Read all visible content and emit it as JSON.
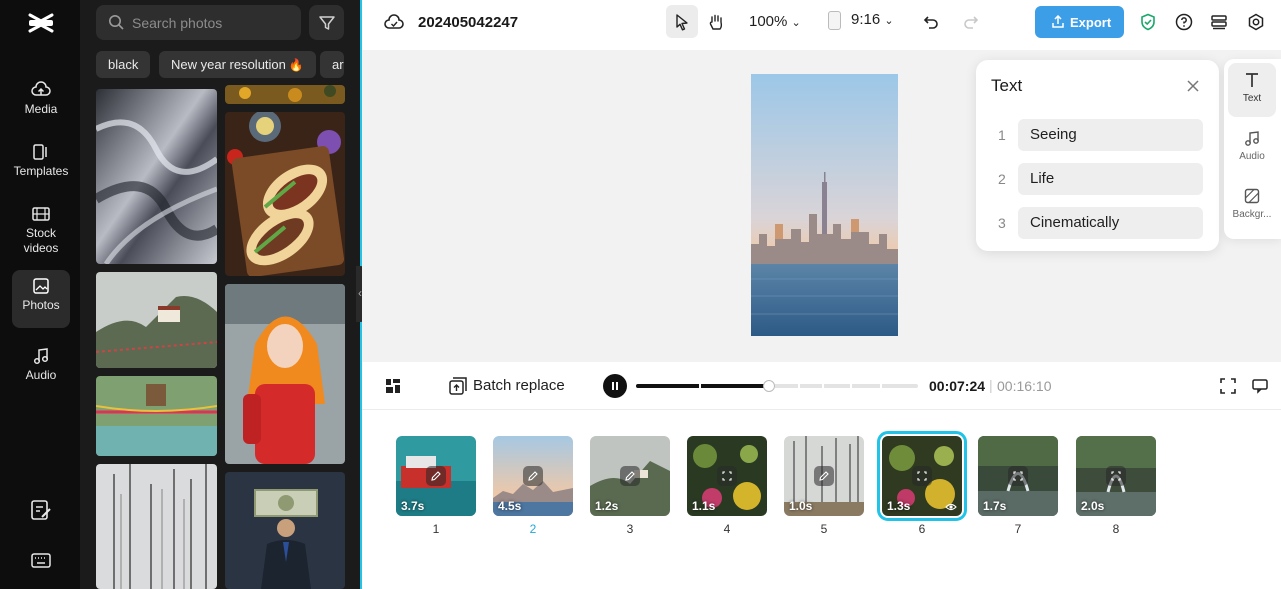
{
  "rail": {
    "items": [
      {
        "label": "Media"
      },
      {
        "label": "Templates"
      },
      {
        "label": "Stock\nvideos"
      },
      {
        "label": "Photos"
      },
      {
        "label": "Audio"
      }
    ]
  },
  "panel": {
    "search_placeholder": "Search photos",
    "chips": [
      "black",
      "New year resolution",
      "ar"
    ]
  },
  "topbar": {
    "project_name": "202405042247",
    "zoom": "100%",
    "ratio": "9:16",
    "export_label": "Export"
  },
  "text_panel": {
    "title": "Text",
    "lines": [
      {
        "num": "1",
        "text": "Seeing"
      },
      {
        "num": "2",
        "text": "Life"
      },
      {
        "num": "3",
        "text": "Cinematically"
      }
    ]
  },
  "right_rail": {
    "items": [
      {
        "label": "Text"
      },
      {
        "label": "Audio"
      },
      {
        "label": "Backgr..."
      }
    ]
  },
  "player": {
    "batch_label": "Batch replace",
    "current_time": "00:07:24",
    "total_time": "00:16:10",
    "progress": 0.47
  },
  "timeline": {
    "clips": [
      {
        "num": "1",
        "duration": "3.7s"
      },
      {
        "num": "2",
        "duration": "4.5s"
      },
      {
        "num": "3",
        "duration": "1.2s"
      },
      {
        "num": "4",
        "duration": "1.1s"
      },
      {
        "num": "5",
        "duration": "1.0s"
      },
      {
        "num": "6",
        "duration": "1.3s"
      },
      {
        "num": "7",
        "duration": "1.7s"
      },
      {
        "num": "8",
        "duration": "2.0s"
      }
    ],
    "current_clip": "2",
    "selected_clip": "6"
  },
  "colors": {
    "accent": "#22c3e6",
    "export": "#3d9ee8",
    "shield": "#1aa86b"
  }
}
